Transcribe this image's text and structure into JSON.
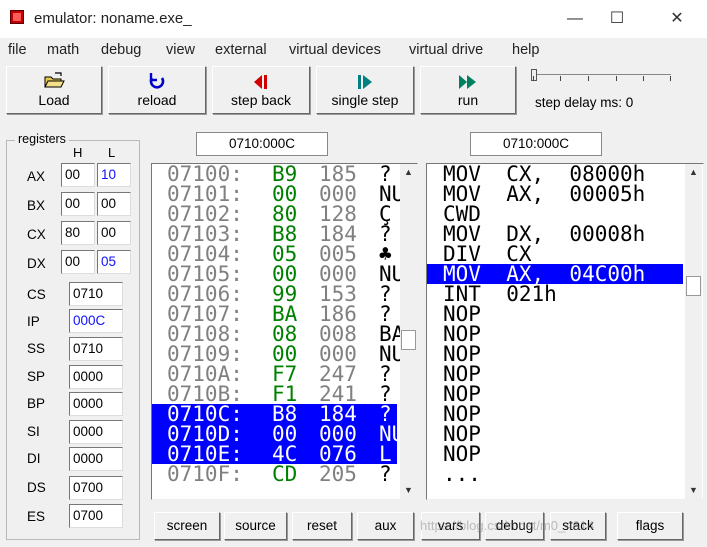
{
  "window": {
    "title": "emulator: noname.exe_",
    "minimize_glyph": "—",
    "maximize_glyph": "☐",
    "close_glyph": "✕"
  },
  "menu": [
    "file",
    "math",
    "debug",
    "view",
    "external",
    "virtual devices",
    "virtual drive",
    "help"
  ],
  "toolbar": {
    "load": "Load",
    "reload": "reload",
    "step_back": "step back",
    "single_step": "single step",
    "run": "run",
    "step_delay": "step delay ms: 0",
    "icons": [
      "open-folder-icon",
      "reload-icon",
      "step-back-icon",
      "single-step-icon",
      "run-icon"
    ],
    "colors": {
      "reload": "#0000c8",
      "step_back": "#d00000",
      "single_step": "#008080",
      "run": "#008060"
    }
  },
  "registers": {
    "title": "registers",
    "h_label": "H",
    "l_label": "L",
    "general": [
      {
        "name": "AX",
        "h": "00",
        "l": "10",
        "l_changed": true
      },
      {
        "name": "BX",
        "h": "00",
        "l": "00",
        "l_changed": false
      },
      {
        "name": "CX",
        "h": "80",
        "l": "00",
        "l_changed": false
      },
      {
        "name": "DX",
        "h": "00",
        "l": "05",
        "l_changed": true
      }
    ],
    "segment": [
      {
        "name": "CS",
        "value": "0710",
        "changed": false
      },
      {
        "name": "IP",
        "value": "000C",
        "changed": true
      },
      {
        "name": "SS",
        "value": "0710",
        "changed": false
      },
      {
        "name": "SP",
        "value": "0000",
        "changed": false
      },
      {
        "name": "BP",
        "value": "0000",
        "changed": false
      },
      {
        "name": "SI",
        "value": "0000",
        "changed": false
      },
      {
        "name": "DI",
        "value": "0000",
        "changed": false
      },
      {
        "name": "DS",
        "value": "0700",
        "changed": false
      },
      {
        "name": "ES",
        "value": "0700",
        "changed": false
      }
    ]
  },
  "memory": {
    "address": "0710:000C",
    "rows": [
      {
        "addr": "07100:",
        "hex": "B9",
        "dec": "185",
        "chr": "?",
        "sel": false
      },
      {
        "addr": "07101:",
        "hex": "00",
        "dec": "000",
        "chr": "NU",
        "sel": false
      },
      {
        "addr": "07102:",
        "hex": "80",
        "dec": "128",
        "chr": "Ç",
        "sel": false
      },
      {
        "addr": "07103:",
        "hex": "B8",
        "dec": "184",
        "chr": "?",
        "sel": false
      },
      {
        "addr": "07104:",
        "hex": "05",
        "dec": "005",
        "chr": "♣",
        "sel": false
      },
      {
        "addr": "07105:",
        "hex": "00",
        "dec": "000",
        "chr": "NU",
        "sel": false
      },
      {
        "addr": "07106:",
        "hex": "99",
        "dec": "153",
        "chr": "?",
        "sel": false
      },
      {
        "addr": "07107:",
        "hex": "BA",
        "dec": "186",
        "chr": "?",
        "sel": false
      },
      {
        "addr": "07108:",
        "hex": "08",
        "dec": "008",
        "chr": "BA",
        "sel": false
      },
      {
        "addr": "07109:",
        "hex": "00",
        "dec": "000",
        "chr": "NU",
        "sel": false
      },
      {
        "addr": "0710A:",
        "hex": "F7",
        "dec": "247",
        "chr": "?",
        "sel": false
      },
      {
        "addr": "0710B:",
        "hex": "F1",
        "dec": "241",
        "chr": "?",
        "sel": false
      },
      {
        "addr": "0710C:",
        "hex": "B8",
        "dec": "184",
        "chr": "?",
        "sel": true
      },
      {
        "addr": "0710D:",
        "hex": "00",
        "dec": "000",
        "chr": "NU",
        "sel": true
      },
      {
        "addr": "0710E:",
        "hex": "4C",
        "dec": "076",
        "chr": "L",
        "sel": true
      },
      {
        "addr": "0710F:",
        "hex": "CD",
        "dec": "205",
        "chr": "?",
        "sel": false
      }
    ]
  },
  "disassembly": {
    "address": "0710:000C",
    "rows": [
      {
        "text": "MOV  CX,  08000h",
        "sel": false
      },
      {
        "text": "MOV  AX,  00005h",
        "sel": false
      },
      {
        "text": "CWD",
        "sel": false
      },
      {
        "text": "MOV  DX,  00008h",
        "sel": false
      },
      {
        "text": "DIV  CX",
        "sel": false
      },
      {
        "text": "MOV  AX,  04C00h",
        "sel": true
      },
      {
        "text": "INT  021h",
        "sel": false
      },
      {
        "text": "NOP",
        "sel": false
      },
      {
        "text": "NOP",
        "sel": false
      },
      {
        "text": "NOP",
        "sel": false
      },
      {
        "text": "NOP",
        "sel": false
      },
      {
        "text": "NOP",
        "sel": false
      },
      {
        "text": "NOP",
        "sel": false
      },
      {
        "text": "NOP",
        "sel": false
      },
      {
        "text": "NOP",
        "sel": false
      },
      {
        "text": "...",
        "sel": false
      }
    ]
  },
  "bottom_buttons": [
    "screen",
    "source",
    "reset",
    "aux",
    "vars",
    "debug",
    "stack",
    "flags"
  ],
  "watermark": "https://blog.csdn.net/m0_4614"
}
